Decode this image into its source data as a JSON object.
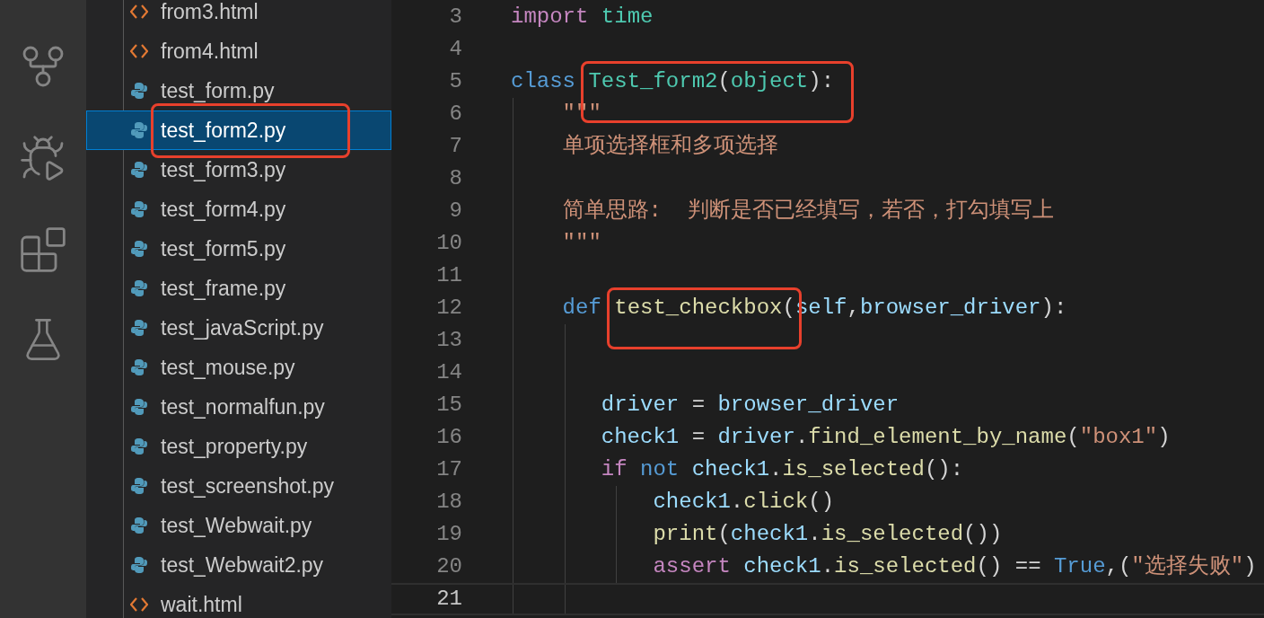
{
  "explorer": {
    "items": [
      {
        "name": "from3.html",
        "kind": "html",
        "selected": false,
        "boxed": false
      },
      {
        "name": "from4.html",
        "kind": "html",
        "selected": false,
        "boxed": false
      },
      {
        "name": "test_form.py",
        "kind": "python",
        "selected": false,
        "boxed": false
      },
      {
        "name": "test_form2.py",
        "kind": "python",
        "selected": true,
        "boxed": true
      },
      {
        "name": "test_form3.py",
        "kind": "python",
        "selected": false,
        "boxed": false
      },
      {
        "name": "test_form4.py",
        "kind": "python",
        "selected": false,
        "boxed": false
      },
      {
        "name": "test_form5.py",
        "kind": "python",
        "selected": false,
        "boxed": false
      },
      {
        "name": "test_frame.py",
        "kind": "python",
        "selected": false,
        "boxed": false
      },
      {
        "name": "test_javaScript.py",
        "kind": "python",
        "selected": false,
        "boxed": false
      },
      {
        "name": "test_mouse.py",
        "kind": "python",
        "selected": false,
        "boxed": false
      },
      {
        "name": "test_normalfun.py",
        "kind": "python",
        "selected": false,
        "boxed": false
      },
      {
        "name": "test_property.py",
        "kind": "python",
        "selected": false,
        "boxed": false
      },
      {
        "name": "test_screenshot.py",
        "kind": "python",
        "selected": false,
        "boxed": false
      },
      {
        "name": "test_Webwait.py",
        "kind": "python",
        "selected": false,
        "boxed": false
      },
      {
        "name": "test_Webwait2.py",
        "kind": "python",
        "selected": false,
        "boxed": false
      },
      {
        "name": "wait.html",
        "kind": "html",
        "selected": false,
        "boxed": false
      }
    ]
  },
  "editor": {
    "lines": [
      {
        "number": "3",
        "current": false,
        "tokens": [
          {
            "kind": "keyword",
            "text": "import"
          },
          {
            "kind": "class",
            "text": " time"
          }
        ]
      },
      {
        "number": "4",
        "current": false
      },
      {
        "number": "5",
        "current": false,
        "tokens": [
          {
            "kind": "storage",
            "text": "class"
          },
          {
            "kind": "class",
            "text": " Test_form2",
            "boxed": true
          },
          {
            "kind": "plain",
            "text": "(",
            "boxed": true
          },
          {
            "kind": "class",
            "text": "object",
            "boxed": true
          },
          {
            "kind": "plain",
            "text": "):",
            "boxed": true
          }
        ]
      },
      {
        "number": "6",
        "current": false,
        "tokens": [
          {
            "kind": "string",
            "text": "    \"\"\""
          }
        ]
      },
      {
        "number": "7",
        "current": false,
        "tokens": [
          {
            "kind": "string",
            "text": "    单项选择框和多项选择"
          }
        ]
      },
      {
        "number": "8",
        "current": false
      },
      {
        "number": "9",
        "current": false,
        "tokens": [
          {
            "kind": "string",
            "text": "    简单思路:  判断是否已经填写，若否，打勾填写上"
          }
        ]
      },
      {
        "number": "10",
        "current": false,
        "tokens": [
          {
            "kind": "string",
            "text": "    \"\"\""
          }
        ]
      },
      {
        "number": "11",
        "current": false
      },
      {
        "number": "12",
        "current": false,
        "tokens": [
          {
            "kind": "storage",
            "text": "    def"
          },
          {
            "kind": "func",
            "text": " test_checkbox",
            "boxed": true
          },
          {
            "kind": "plain",
            "text": "("
          },
          {
            "kind": "var",
            "text": "self"
          },
          {
            "kind": "plain",
            "text": ","
          },
          {
            "kind": "var",
            "text": "browser_driver"
          },
          {
            "kind": "plain",
            "text": "):"
          }
        ]
      },
      {
        "number": "13",
        "current": false
      },
      {
        "number": "14",
        "current": false
      },
      {
        "number": "15",
        "current": false,
        "tokens": [
          {
            "kind": "var",
            "text": "       driver"
          },
          {
            "kind": "plain",
            "text": " = "
          },
          {
            "kind": "var",
            "text": "browser_driver"
          }
        ]
      },
      {
        "number": "16",
        "current": false,
        "tokens": [
          {
            "kind": "var",
            "text": "       check1"
          },
          {
            "kind": "plain",
            "text": " = "
          },
          {
            "kind": "var",
            "text": "driver"
          },
          {
            "kind": "plain",
            "text": "."
          },
          {
            "kind": "func",
            "text": "find_element_by_name"
          },
          {
            "kind": "plain",
            "text": "("
          },
          {
            "kind": "string",
            "text": "\"box1\""
          },
          {
            "kind": "plain",
            "text": ")"
          }
        ]
      },
      {
        "number": "17",
        "current": false,
        "tokens": [
          {
            "kind": "keyword",
            "text": "       if"
          },
          {
            "kind": "storage",
            "text": " not"
          },
          {
            "kind": "var",
            "text": " check1"
          },
          {
            "kind": "plain",
            "text": "."
          },
          {
            "kind": "func",
            "text": "is_selected"
          },
          {
            "kind": "plain",
            "text": "():"
          }
        ]
      },
      {
        "number": "18",
        "current": false,
        "tokens": [
          {
            "kind": "var",
            "text": "           check1"
          },
          {
            "kind": "plain",
            "text": "."
          },
          {
            "kind": "func",
            "text": "click"
          },
          {
            "kind": "plain",
            "text": "()"
          }
        ]
      },
      {
        "number": "19",
        "current": false,
        "tokens": [
          {
            "kind": "func",
            "text": "           print"
          },
          {
            "kind": "plain",
            "text": "("
          },
          {
            "kind": "var",
            "text": "check1"
          },
          {
            "kind": "plain",
            "text": "."
          },
          {
            "kind": "func",
            "text": "is_selected"
          },
          {
            "kind": "plain",
            "text": "())"
          }
        ]
      },
      {
        "number": "20",
        "current": false,
        "tokens": [
          {
            "kind": "keyword",
            "text": "           assert"
          },
          {
            "kind": "var",
            "text": " check1"
          },
          {
            "kind": "plain",
            "text": "."
          },
          {
            "kind": "func",
            "text": "is_selected"
          },
          {
            "kind": "plain",
            "text": "() == "
          },
          {
            "kind": "storage",
            "text": "True"
          },
          {
            "kind": "plain",
            "text": ",("
          },
          {
            "kind": "string",
            "text": "\"选择失败\""
          },
          {
            "kind": "plain",
            "text": ")"
          }
        ]
      },
      {
        "number": "21",
        "current": true
      }
    ]
  }
}
